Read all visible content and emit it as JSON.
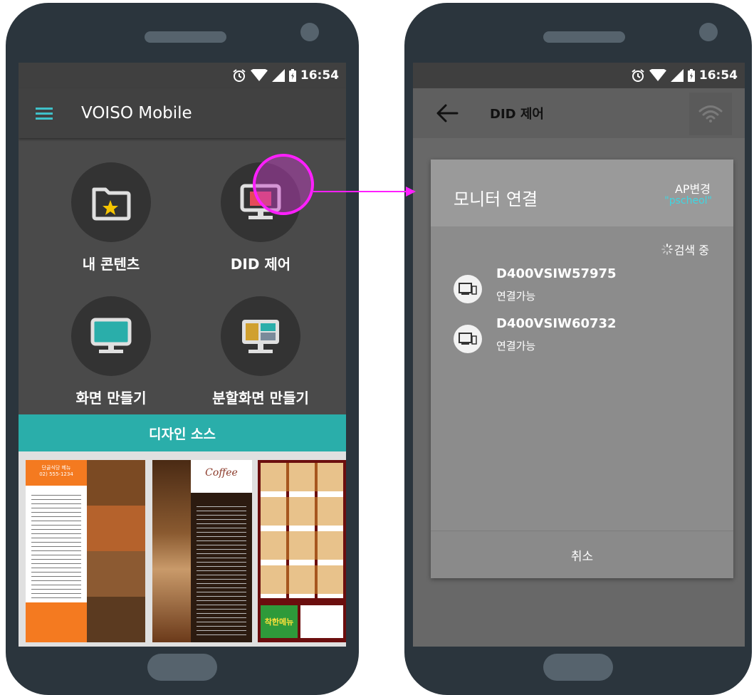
{
  "status_bar": {
    "time": "16:54"
  },
  "left_screen": {
    "app_title": "VOISO Mobile",
    "menu": [
      {
        "label": "내 콘텐츠",
        "icon": "folder-star-icon"
      },
      {
        "label": "DID 제어",
        "icon": "monitor-control-icon"
      },
      {
        "label": "화면 만들기",
        "icon": "monitor-icon"
      },
      {
        "label": "분할화면 만들기",
        "icon": "split-monitor-icon"
      }
    ],
    "design_source_label": "디자인 소스",
    "thumbnails": [
      {
        "name": "korean-menu-board",
        "title": "단골식당 메뉴",
        "phone": "02) 555-1234"
      },
      {
        "name": "coffee-menu-board",
        "title": "Coffee"
      },
      {
        "name": "burger-menu-board",
        "promo": "착한메뉴"
      }
    ]
  },
  "right_screen": {
    "title": "DID 제어",
    "dialog": {
      "title": "모니터 연결",
      "ap_change_label": "AP변경",
      "ap_ssid": "\"pscheol\"",
      "search_status": "검색 중",
      "devices": [
        {
          "name": "D400VSIW57975",
          "status": "연결가능"
        },
        {
          "name": "D400VSIW60732",
          "status": "연결가능"
        }
      ],
      "cancel_label": "취소"
    }
  },
  "colors": {
    "accent_teal": "#2aaeaa",
    "highlight_magenta": "#ff1fff",
    "phone_body": "#2b353d"
  }
}
